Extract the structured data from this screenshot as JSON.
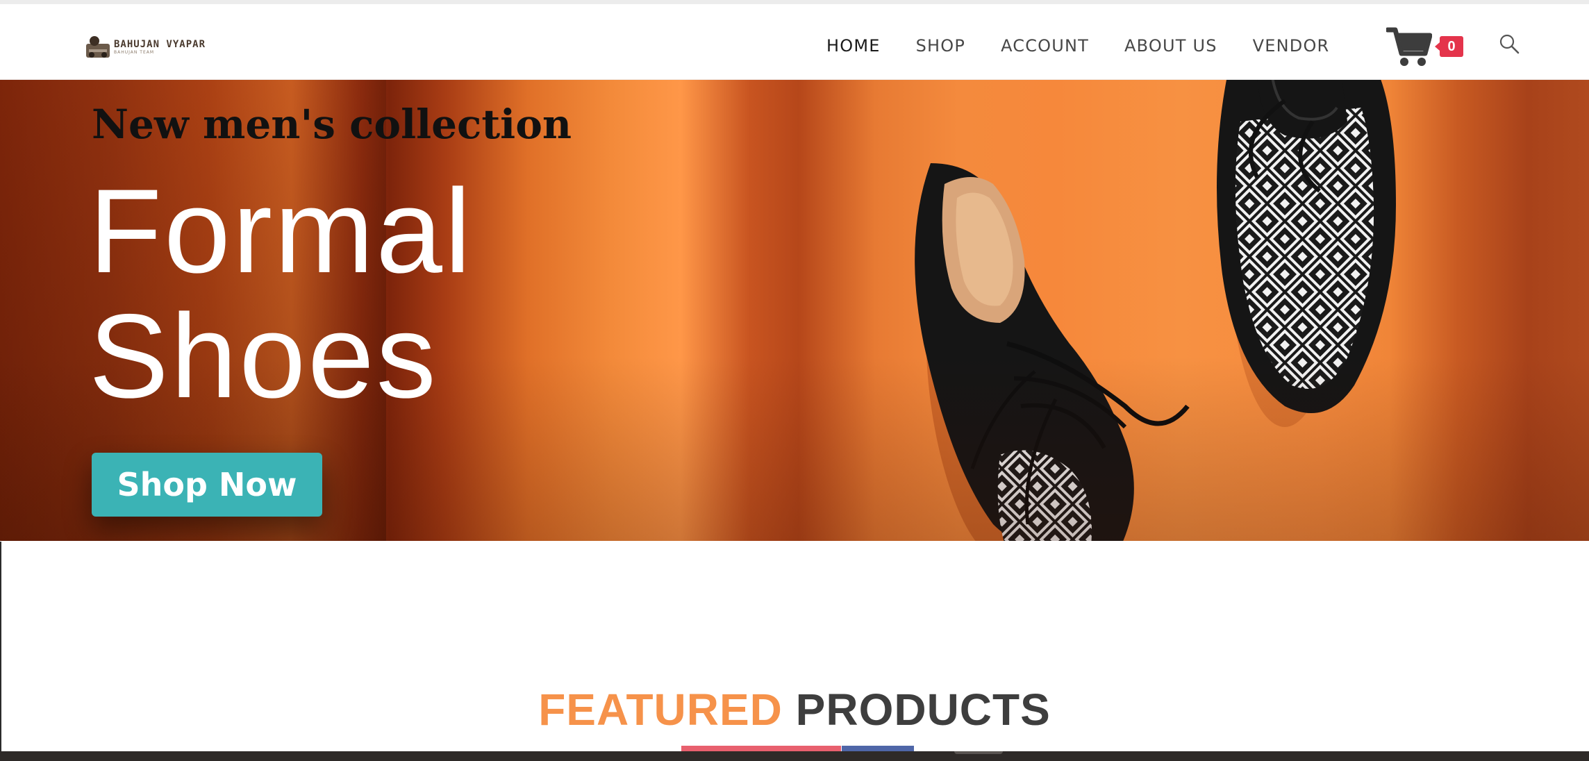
{
  "brand": {
    "name": "BAHUJAN VYAPAR",
    "tagline": "BAHUJAN TEAM",
    "colors": {
      "accent": "#f6924a",
      "button": "#3bb3b5",
      "badge": "#e4344b",
      "text": "#474747"
    }
  },
  "nav": {
    "items": [
      {
        "label": "HOME",
        "active": true
      },
      {
        "label": "SHOP",
        "active": false
      },
      {
        "label": "ACCOUNT",
        "active": false
      },
      {
        "label": "ABOUT US",
        "active": false
      },
      {
        "label": "VENDOR",
        "active": false
      }
    ],
    "cart": {
      "icon": "cart-icon",
      "count": "0"
    },
    "search": {
      "icon": "search-icon"
    }
  },
  "hero": {
    "kicker": "New men's collection",
    "title_line1": "Formal",
    "title_line2": "Shoes",
    "cta_label": "Shop Now"
  },
  "featured": {
    "word1": "FEATURED",
    "word2": "PRODUCTS"
  }
}
